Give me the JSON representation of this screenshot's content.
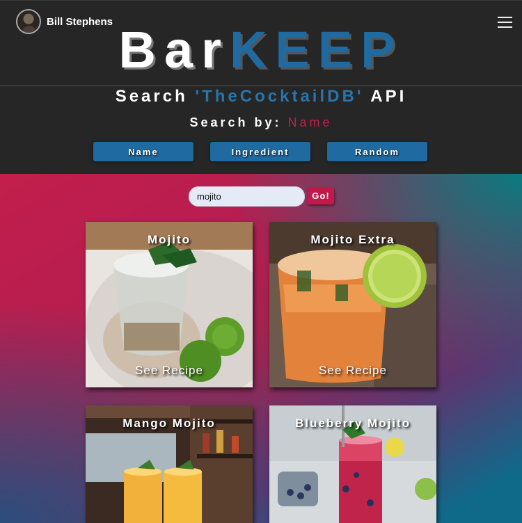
{
  "header": {
    "username": "Bill Stephens",
    "logo": {
      "part1": "Bar",
      "part2": "KEEP"
    },
    "search_title": {
      "prefix": "Search ",
      "api": "'TheCocktailDB'",
      "suffix": " API"
    },
    "search_by": {
      "label": "Search by: ",
      "mode": "Name"
    },
    "mode_buttons": [
      "Name",
      "Ingredient",
      "Random"
    ]
  },
  "search": {
    "value": "mojito",
    "go_label": "Go!"
  },
  "cards": [
    {
      "title": "Mojito",
      "action": "See Recipe"
    },
    {
      "title": "Mojito Extra",
      "action": "See Recipe"
    },
    {
      "title": "Mango Mojito"
    },
    {
      "title": "Blueberry Mojito"
    }
  ],
  "colors": {
    "accent_blue": "#1f6aa0",
    "accent_red": "#c2194b",
    "header_bg": "#262626"
  },
  "icons": [
    "hamburger-menu-icon"
  ]
}
